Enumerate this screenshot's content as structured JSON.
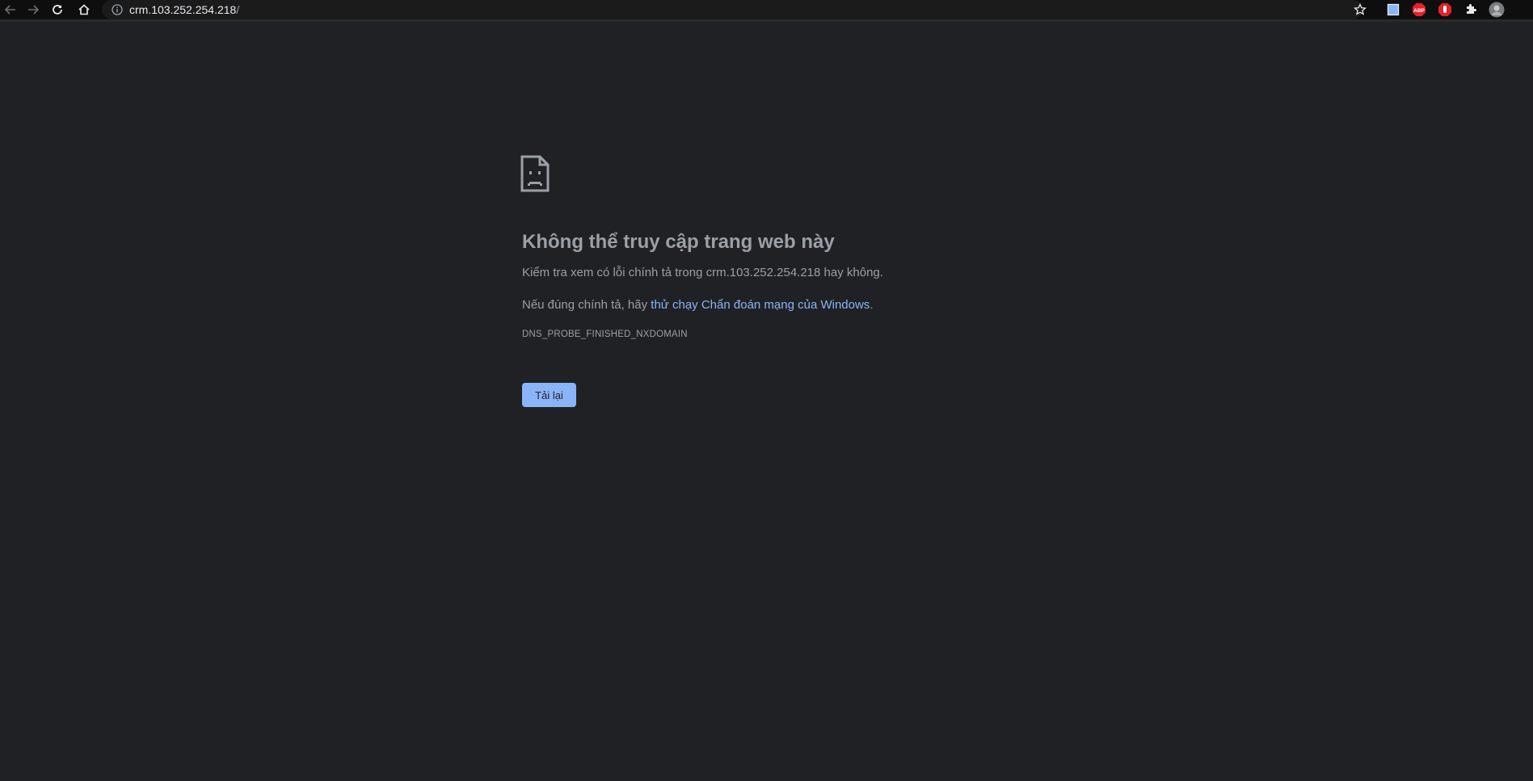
{
  "browser": {
    "url_host": "crm.103.252.254.218",
    "url_path": "/",
    "icons": {
      "back": "back-arrow-icon",
      "forward": "forward-arrow-icon",
      "reload": "reload-icon",
      "home": "home-icon",
      "site_info": "info-icon",
      "bookmark": "star-icon"
    },
    "extensions": [
      {
        "name": "blue-square-extension-icon",
        "color": "#8ab4f8"
      },
      {
        "name": "adblock-plus-icon",
        "label": "ABP",
        "color": "#e8202a"
      },
      {
        "name": "stop-hand-extension-icon",
        "color": "#e8202a"
      },
      {
        "name": "puzzle-extensions-icon",
        "color": "#e8eaed"
      },
      {
        "name": "profile-avatar",
        "color": "#7a7d80"
      }
    ]
  },
  "error_page": {
    "icon": "sad-page-icon",
    "title": "Không thể truy cập trang web này",
    "line1": "Kiểm tra xem có lỗi chính tả trong crm.103.252.254.218 hay không.",
    "line2_prefix": "Nếu đúng chính tả, hãy ",
    "line2_link": "thử chạy Chẩn đoán mạng của Windows",
    "line2_suffix": ".",
    "error_code": "DNS_PROBE_FINISHED_NXDOMAIN",
    "reload_label": "Tải lại"
  },
  "colors": {
    "background": "#202124",
    "text": "#9aa0a6",
    "link": "#8ab4f8",
    "button": "#8ab4f8"
  }
}
